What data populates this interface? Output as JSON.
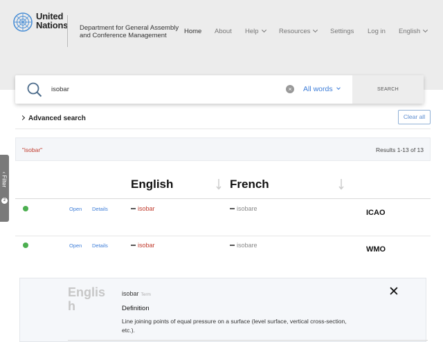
{
  "header": {
    "logo_line1": "United",
    "logo_line2": "Nations",
    "department": "Department for General Assembly and Conference Management",
    "nav": {
      "home": "Home",
      "about": "About",
      "help": "Help",
      "resources": "Resources",
      "settings": "Settings",
      "login": "Log in",
      "language": "English"
    }
  },
  "search": {
    "query": "isobar",
    "placeholder": "",
    "mode": "All words",
    "button": "SEARCH",
    "clear_icon": "x-circle-icon"
  },
  "advanced_search": "Advanced search",
  "clear_all": "Clear all",
  "results_bar": {
    "query_tag": "\"isobar\"",
    "count": "Results 1-13 of 13"
  },
  "filter_tab": {
    "label": "Filter",
    "badge": "2"
  },
  "table": {
    "columns": [
      "English",
      "French"
    ],
    "rows": [
      {
        "status_color": "#4caf50",
        "open": "Open",
        "details": "Details",
        "english": "isobar",
        "french": "isobare",
        "org": "ICAO"
      },
      {
        "status_color": "#4caf50",
        "open": "Open",
        "details": "Details",
        "english": "isobar",
        "french": "isobare",
        "org": "WMO"
      }
    ]
  },
  "detail_panel": {
    "language": "English",
    "term": "isobar",
    "term_type": "Term",
    "definition_heading": "Definition",
    "definition_text": "Line joining points of equal pressure on a surface (level surface, vertical cross-section, etc.).",
    "close_icon": "close-icon"
  },
  "colors": {
    "accent_blue": "#3d7dd8",
    "term_red": "#c0392b",
    "status_green": "#4caf50",
    "header_gray": "#ececec"
  }
}
